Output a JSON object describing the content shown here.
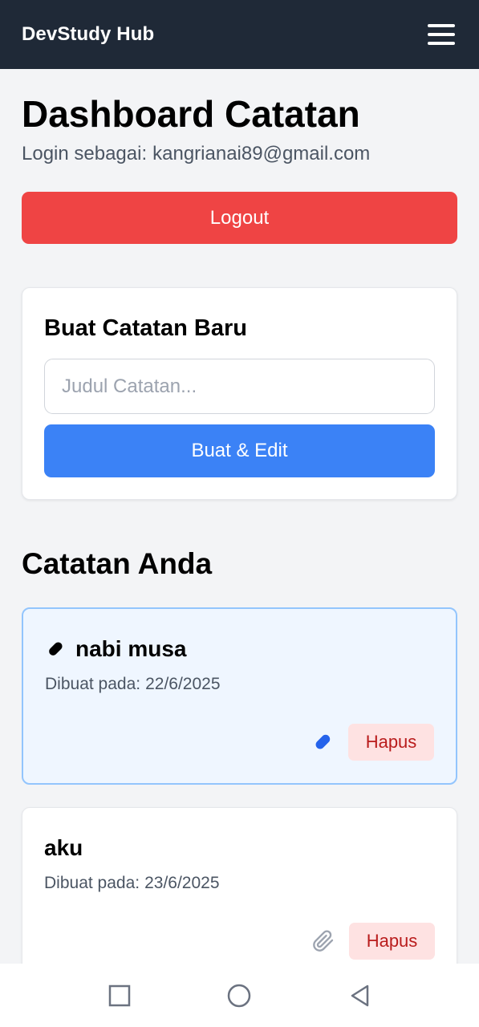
{
  "header": {
    "brand": "DevStudy Hub",
    "menu_icon": "hamburger-menu-icon"
  },
  "dashboard": {
    "title": "Dashboard Catatan",
    "login_label": "Login sebagai:",
    "user_email": "kangrianai89@gmail.com",
    "logout_label": "Logout"
  },
  "new_note": {
    "title": "Buat Catatan Baru",
    "input_placeholder": "Judul Catatan...",
    "input_value": "",
    "create_label": "Buat & Edit"
  },
  "notes_section": {
    "title": "Catatan Anda",
    "date_prefix": "Dibuat pada:",
    "delete_label": "Hapus",
    "notes": [
      {
        "title": "nabi musa",
        "date": "22/6/2025",
        "pinned": true,
        "pin_icon": "pin-icon",
        "action_icon": "pin-icon",
        "highlight_color": "#eff6ff"
      },
      {
        "title": "aku",
        "date": "23/6/2025",
        "pinned": false,
        "action_icon": "paperclip-icon"
      }
    ]
  },
  "colors": {
    "header_bg": "#1f2937",
    "logout": "#ef4444",
    "primary": "#3b82f6",
    "delete_bg": "#fee2e2",
    "delete_text": "#b91c1c"
  },
  "system_nav": {
    "recents_icon": "square-icon",
    "home_icon": "circle-icon",
    "back_icon": "back-triangle-icon"
  }
}
